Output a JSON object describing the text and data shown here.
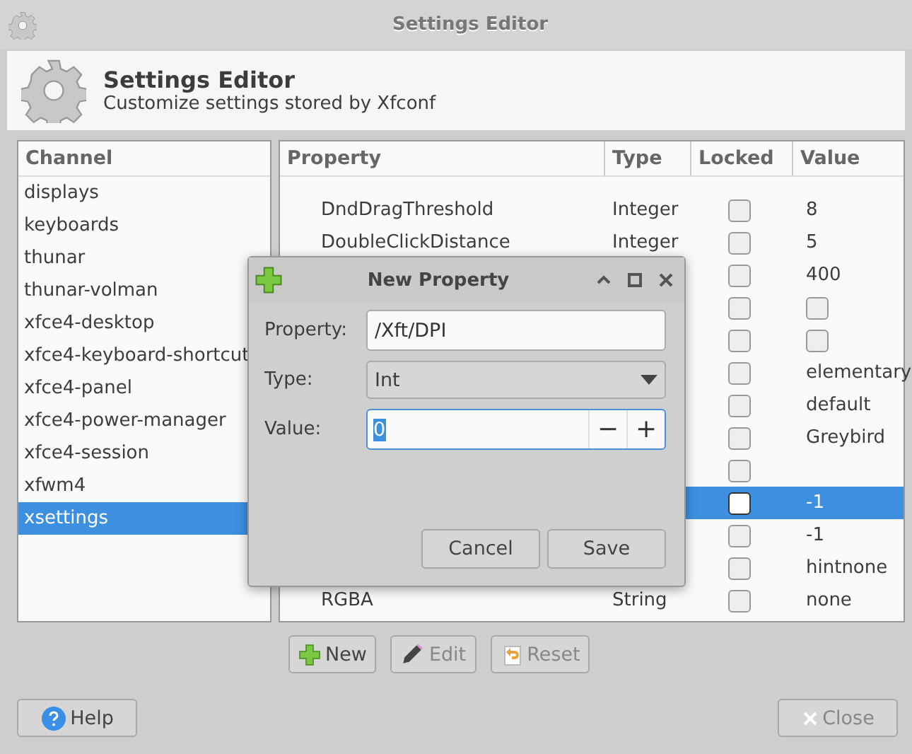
{
  "window": {
    "title": "Settings Editor"
  },
  "header": {
    "title": "Settings Editor",
    "subtitle": "Customize settings stored by Xfconf"
  },
  "channels": {
    "heading": "Channel",
    "items": [
      {
        "label": "displays",
        "selected": false
      },
      {
        "label": "keyboards",
        "selected": false
      },
      {
        "label": "thunar",
        "selected": false
      },
      {
        "label": "thunar-volman",
        "selected": false
      },
      {
        "label": "xfce4-desktop",
        "selected": false
      },
      {
        "label": "xfce4-keyboard-shortcut",
        "selected": false
      },
      {
        "label": "xfce4-panel",
        "selected": false
      },
      {
        "label": "xfce4-power-manager",
        "selected": false
      },
      {
        "label": "xfce4-session",
        "selected": false
      },
      {
        "label": "xfwm4",
        "selected": false
      },
      {
        "label": "xsettings",
        "selected": true
      }
    ]
  },
  "table": {
    "columns": [
      "Property",
      "Type",
      "Locked",
      "Value"
    ],
    "rows": [
      {
        "property": "DndDragThreshold",
        "type": "Integer",
        "locked": false,
        "kind": "text",
        "value": "8",
        "selected": false
      },
      {
        "property": "DoubleClickDistance",
        "type": "Integer",
        "locked": false,
        "kind": "text",
        "value": "5",
        "selected": false
      },
      {
        "locked": false,
        "kind": "text",
        "value": "400",
        "selected": false
      },
      {
        "locked": false,
        "kind": "checkbox",
        "checked": false,
        "selected": false
      },
      {
        "locked": false,
        "kind": "checkbox",
        "checked": false,
        "selected": false
      },
      {
        "locked": false,
        "kind": "text",
        "value": "elementary",
        "selected": false
      },
      {
        "locked": false,
        "kind": "text",
        "value": "default",
        "selected": false
      },
      {
        "locked": false,
        "kind": "text",
        "value": "Greybird",
        "selected": false
      },
      {
        "locked": false,
        "kind": "text",
        "selected": false
      },
      {
        "locked": false,
        "kind": "text",
        "value": "-1",
        "selected": true
      },
      {
        "locked": false,
        "kind": "text",
        "value": "-1",
        "selected": false
      },
      {
        "locked": false,
        "kind": "text",
        "value": "hintnone",
        "selected": false
      },
      {
        "property": "RGBA",
        "type": "String",
        "locked": false,
        "kind": "text",
        "value": "none",
        "selected": false
      }
    ]
  },
  "actions": [
    {
      "label": "New",
      "kind": "new",
      "disabled": false
    },
    {
      "label": "Edit",
      "kind": "edit",
      "disabled": true
    },
    {
      "label": "Reset",
      "kind": "reset",
      "disabled": true
    }
  ],
  "footer": [
    {
      "label": "Help",
      "kind": "help",
      "disabled": false
    },
    {
      "label": "Close",
      "kind": "close",
      "disabled": true
    }
  ],
  "dialog": {
    "title": "New Property",
    "fields": [
      {
        "label": "Property:",
        "kind": "text",
        "value": "/Xft/DPI"
      },
      {
        "label": "Type:",
        "kind": "select",
        "value": "Int"
      },
      {
        "label": "Value:",
        "kind": "spin",
        "value": "0",
        "minus": "−",
        "plus": "+"
      }
    ],
    "buttons": [
      "Cancel",
      "Save"
    ]
  }
}
